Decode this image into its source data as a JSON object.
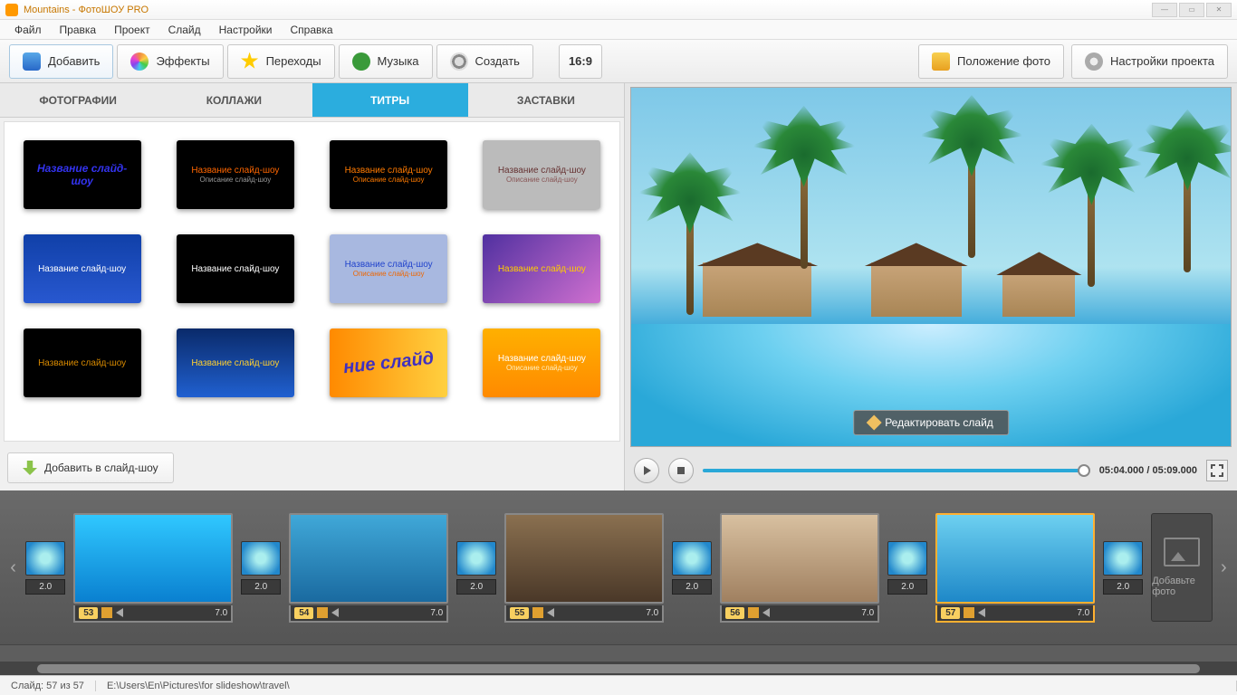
{
  "window": {
    "title": "Mountains - ФотоШОУ PRO"
  },
  "menu": {
    "items": [
      "Файл",
      "Правка",
      "Проект",
      "Слайд",
      "Настройки",
      "Справка"
    ]
  },
  "toolbar": {
    "add": "Добавить",
    "effects": "Эффекты",
    "transitions": "Переходы",
    "music": "Музыка",
    "create": "Создать",
    "aspect": "16:9",
    "photo_position": "Положение фото",
    "project_settings": "Настройки проекта"
  },
  "subtabs": {
    "photos": "ФОТОГРАФИИ",
    "collages": "КОЛЛАЖИ",
    "titles": "ТИТРЫ",
    "intros": "ЗАСТАВКИ",
    "active": "titles"
  },
  "templates": [
    {
      "line1": "Название слайд-шоу",
      "line2": "",
      "bg": "#000",
      "c1": "#3333ee",
      "c2": ""
    },
    {
      "line1": "Название слайд-шоу",
      "line2": "Описание слайд-шоу",
      "bg": "#000",
      "c1": "#ff6600",
      "c2": "#999"
    },
    {
      "line1": "Название слайд-шоу",
      "line2": "Описание слайд-шоу",
      "bg": "#000",
      "c1": "#ff7a00",
      "c2": "#ff7a00"
    },
    {
      "line1": "Название слайд-шоу",
      "line2": "Описание слайд-шоу",
      "bg": "#bbb",
      "c1": "#633",
      "c2": "#855"
    },
    {
      "line1": "Название слайд-шоу",
      "line2": "",
      "bg": "linear-gradient(#1040a8,#2858d0)",
      "c1": "#fff",
      "c2": ""
    },
    {
      "line1": "Название слайд-шоу",
      "line2": "",
      "bg": "#000",
      "c1": "#fff",
      "c2": ""
    },
    {
      "line1": "Название слайд-шоу",
      "line2": "Описание слайд-шоу",
      "bg": "#a8b8e0",
      "c1": "#2244cc",
      "c2": "#ee6600"
    },
    {
      "line1": "Название слайд-шоу",
      "line2": "",
      "bg": "linear-gradient(135deg,#5030a0,#d070d0)",
      "c1": "#ffcc00",
      "c2": ""
    },
    {
      "line1": "Название слайд-шоу",
      "line2": "",
      "bg": "#000",
      "c1": "#d88a00",
      "c2": ""
    },
    {
      "line1": "Название слайд-шоу",
      "line2": "",
      "bg": "linear-gradient(#0a2a6a,#2060d0)",
      "c1": "#ffd030",
      "c2": ""
    },
    {
      "line1": "ние слайд",
      "line2": "",
      "bg": "linear-gradient(90deg,#ff8a00,#ffd040)",
      "c1": "#4030c0",
      "c2": ""
    },
    {
      "line1": "Название слайд-шоу",
      "line2": "Описание слайд-шоу",
      "bg": "linear-gradient(#ffb000,#ff8a00)",
      "c1": "#fff",
      "c2": "#fff0c0"
    }
  ],
  "add_to_slideshow": "Добавить в слайд-шоу",
  "preview": {
    "edit_slide": "Редактировать слайд"
  },
  "playback": {
    "current": "05:04.000",
    "total": "05:09.000",
    "progress": 0.985
  },
  "timeline": {
    "transition_dur": "2.0",
    "slide_dur": "7.0",
    "slides": [
      {
        "num": "53",
        "bg": "linear-gradient(#30c8ff,#0a80d0)"
      },
      {
        "num": "54",
        "bg": "linear-gradient(#40a8d8,#1a6aa0)"
      },
      {
        "num": "55",
        "bg": "linear-gradient(#8a7050,#4a3828)"
      },
      {
        "num": "56",
        "bg": "linear-gradient(#d8c0a0,#a08060)"
      },
      {
        "num": "57",
        "bg": "linear-gradient(#6dd0f0,#1e88c8)"
      }
    ],
    "selected": "57",
    "add_photo": "Добавьте фото"
  },
  "status": {
    "slide_info": "Слайд: 57 из 57",
    "path": "E:\\Users\\En\\Pictures\\for slideshow\\travel\\"
  },
  "colors": {
    "accent": "#2badde",
    "highlight": "#ffb030"
  }
}
